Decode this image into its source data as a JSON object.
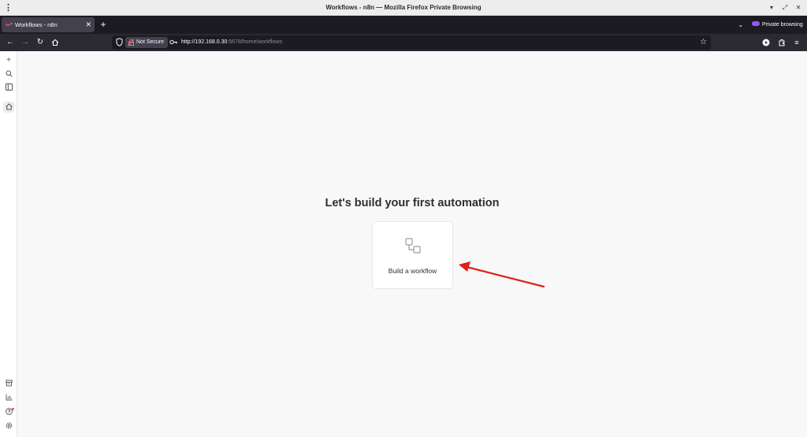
{
  "window": {
    "title": "Workflows - n8n — Mozilla Firefox Private Browsing",
    "kebab_icon": "kebab-icon",
    "minimize_icon": "minimize-icon",
    "maximize_icon": "maximize-icon",
    "close_icon": "close-icon"
  },
  "tabs": [
    {
      "label": "Workflows - n8n",
      "favicon": "n8n-favicon",
      "active": true
    }
  ],
  "tabstrip": {
    "new_tab_icon": "plus-icon",
    "list_tabs_icon": "chevron-down-icon",
    "private_label": "Private browsing"
  },
  "navbar": {
    "back_icon": "back-arrow-icon",
    "forward_icon": "forward-arrow-icon",
    "reload_icon": "reload-icon",
    "home_icon": "home-icon",
    "security_label": "Not Secure",
    "url_host": "http://192.168.0.30",
    "url_rest": ":5678/home/workflows"
  },
  "sidebar": {
    "items": [
      {
        "name": "add",
        "icon": "plus-icon"
      },
      {
        "name": "search",
        "icon": "search-icon"
      },
      {
        "name": "collapse",
        "icon": "panel-icon"
      },
      {
        "name": "home",
        "icon": "home-icon",
        "active": true
      }
    ],
    "bottom_items": [
      {
        "name": "templates",
        "icon": "box-icon"
      },
      {
        "name": "insights",
        "icon": "bar-chart-icon"
      },
      {
        "name": "help",
        "icon": "help-icon"
      },
      {
        "name": "settings",
        "icon": "gear-icon"
      }
    ]
  },
  "main": {
    "heading": "Let's build your first automation",
    "card_label": "Build a workflow"
  },
  "colors": {
    "accent": "#ea4b71",
    "annotation_arrow": "#e0201b",
    "private": "#9059ff"
  }
}
